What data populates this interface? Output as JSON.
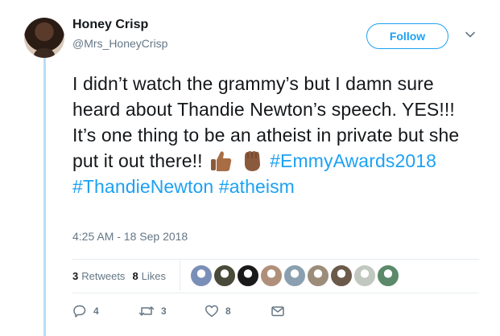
{
  "user": {
    "display_name": "Honey Crisp",
    "handle": "@Mrs_HoneyCrisp"
  },
  "follow_button": {
    "label": "Follow"
  },
  "tweet": {
    "text": "I didn’t watch the grammy’s but I damn sure heard about Thandie Newton’s speech. YES!!! It’s one thing to be an atheist in private but she put it out there!!",
    "emojis": [
      "thumbs-up-medium-dark-skin",
      "raised-fist-medium-dark-skin"
    ],
    "hashtags": [
      "#EmmyAwards2018",
      "#ThandieNewton",
      "#atheism"
    ],
    "timestamp": "4:25 AM - 18 Sep 2018"
  },
  "stats": {
    "retweets_count": "3",
    "retweets_label": "Retweets",
    "likes_count": "8",
    "likes_label": "Likes",
    "liker_avatar_colors": [
      "#7a8fb8",
      "#4a4a3a",
      "#1a1a1a",
      "#b08f7a",
      "#8aa0b0",
      "#9b8d7a",
      "#6b5a4a",
      "#c0c8c0",
      "#5a8a6a"
    ]
  },
  "actions": {
    "reply_count": "4",
    "retweet_count": "3",
    "like_count": "8"
  },
  "colors": {
    "accent": "#1da1f2",
    "text": "#14171a",
    "muted": "#657786",
    "thread_line": "#b8dff5"
  }
}
